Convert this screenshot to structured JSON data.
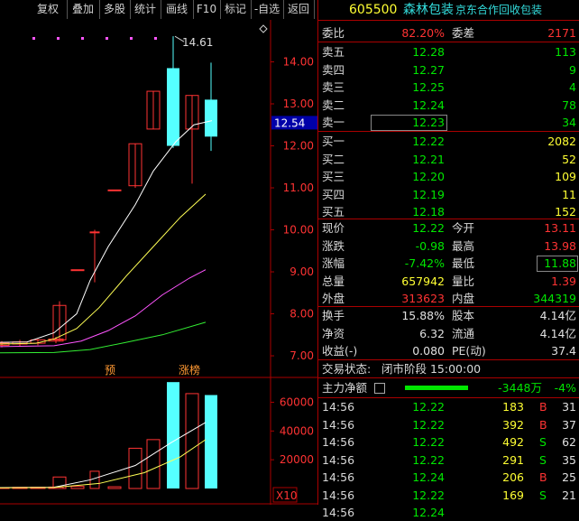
{
  "toolbar": {
    "buttons": [
      "复权",
      "叠加",
      "多股",
      "统计",
      "画线",
      "F10",
      "标记",
      "-自选",
      "返回"
    ]
  },
  "chart": {
    "annotation_high": "14.61",
    "current_price_tag": "12.54",
    "price_ticks": [
      "14.00",
      "13.00",
      "12.00",
      "11.00",
      "10.00",
      "9.00",
      "8.00",
      "7.00"
    ],
    "volume_ticks": [
      "60000",
      "40000",
      "20000"
    ],
    "volume_unit": "X10",
    "tag_pre": "预",
    "tag_limit_up": "涨榜",
    "settings_icon": "diamond-icon",
    "colors": {
      "up": "#ff3333",
      "down": "#55ffff",
      "ma5": "#ffffff",
      "ma10": "#ffff55",
      "ma20": "#ff55ff",
      "ma60": "#33ee33"
    }
  },
  "chart_data": {
    "type": "candlestick",
    "candles": [
      {
        "o": 7.25,
        "h": 7.35,
        "l": 7.2,
        "c": 7.3
      },
      {
        "o": 7.28,
        "h": 7.38,
        "l": 7.22,
        "c": 7.33
      },
      {
        "o": 7.3,
        "h": 7.4,
        "l": 7.25,
        "c": 7.38
      },
      {
        "o": 7.35,
        "h": 7.45,
        "l": 7.3,
        "c": 7.4
      },
      {
        "o": 7.38,
        "h": 8.3,
        "l": 7.35,
        "c": 8.2
      },
      {
        "o": 9.05,
        "h": 9.05,
        "l": 9.05,
        "c": 9.05
      },
      {
        "o": 9.95,
        "h": 10.0,
        "l": 8.75,
        "c": 9.95
      },
      {
        "o": 10.95,
        "h": 10.95,
        "l": 10.95,
        "c": 10.95
      },
      {
        "o": 11.05,
        "h": 12.05,
        "l": 11.0,
        "c": 12.05
      },
      {
        "o": 12.4,
        "h": 13.3,
        "l": 12.4,
        "c": 13.3
      },
      {
        "o": 13.85,
        "h": 14.61,
        "l": 11.95,
        "c": 12.0
      },
      {
        "o": 12.4,
        "h": 13.2,
        "l": 11.1,
        "c": 13.2
      },
      {
        "o": 13.1,
        "h": 13.98,
        "l": 11.88,
        "c": 12.22
      }
    ],
    "volumes": [
      600,
      800,
      900,
      1000,
      8000,
      1500,
      12000,
      1200,
      28000,
      34000,
      74000,
      66000,
      65000
    ],
    "y_range": [
      6.7,
      15.0
    ],
    "vol_range": [
      0,
      76000
    ]
  },
  "quote": {
    "code": "605500",
    "name": "森林包装",
    "note": "京东合作回收包装",
    "weibi_label": "委比",
    "weibi": "82.20%",
    "weicha_label": "委差",
    "weicha": "2171",
    "asks": [
      {
        "label": "卖五",
        "price": "12.28",
        "vol": "113"
      },
      {
        "label": "卖四",
        "price": "12.27",
        "vol": "9"
      },
      {
        "label": "卖三",
        "price": "12.25",
        "vol": "4"
      },
      {
        "label": "卖二",
        "price": "12.24",
        "vol": "78"
      },
      {
        "label": "卖一",
        "price": "12.23",
        "vol": "34"
      }
    ],
    "bids": [
      {
        "label": "买一",
        "price": "12.22",
        "vol": "2082"
      },
      {
        "label": "买二",
        "price": "12.21",
        "vol": "52"
      },
      {
        "label": "买三",
        "price": "12.20",
        "vol": "109"
      },
      {
        "label": "买四",
        "price": "12.19",
        "vol": "11"
      },
      {
        "label": "买五",
        "price": "12.18",
        "vol": "152"
      }
    ],
    "stats": [
      {
        "l1": "现价",
        "v1": "12.22",
        "c1": "green",
        "l2": "今开",
        "v2": "13.11",
        "c2": "red"
      },
      {
        "l1": "涨跌",
        "v1": "-0.98",
        "c1": "green",
        "l2": "最高",
        "v2": "13.98",
        "c2": "red"
      },
      {
        "l1": "涨幅",
        "v1": "-7.42%",
        "c1": "green",
        "l2": "最低",
        "v2": "11.88",
        "c2": "green"
      },
      {
        "l1": "总量",
        "v1": "657942",
        "c1": "yellow",
        "l2": "量比",
        "v2": "1.39",
        "c2": "red"
      },
      {
        "l1": "外盘",
        "v1": "313623",
        "c1": "red",
        "l2": "内盘",
        "v2": "344319",
        "c2": "green"
      }
    ],
    "stats2": [
      {
        "l1": "换手",
        "v1": "15.88%",
        "l2": "股本",
        "v2": "4.14亿"
      },
      {
        "l1": "净资",
        "v1": "6.32",
        "l2": "流通",
        "v2": "4.14亿"
      },
      {
        "l1": "收益(-)",
        "v1": "0.080",
        "l2": "PE(动)",
        "v2": "37.4"
      }
    ],
    "status_label": "交易状态:",
    "status_value": "闭市阶段 15:00:00",
    "main_flow_label": "主力净额",
    "main_flow_value": "-3448万",
    "main_flow_pct": "-4%",
    "ticks": [
      {
        "t": "14:56",
        "p": "12.22",
        "v": "183",
        "s": "B",
        "n": "31"
      },
      {
        "t": "14:56",
        "p": "12.22",
        "v": "392",
        "s": "B",
        "n": "37"
      },
      {
        "t": "14:56",
        "p": "12.22",
        "v": "492",
        "s": "S",
        "n": "62"
      },
      {
        "t": "14:56",
        "p": "12.22",
        "v": "291",
        "s": "S",
        "n": "35"
      },
      {
        "t": "14:56",
        "p": "12.24",
        "v": "206",
        "s": "B",
        "n": "25"
      },
      {
        "t": "14:56",
        "p": "12.22",
        "v": "169",
        "s": "S",
        "n": "21"
      },
      {
        "t": "14:56",
        "p": "12.24",
        "v": "",
        "s": "",
        "n": ""
      }
    ]
  }
}
